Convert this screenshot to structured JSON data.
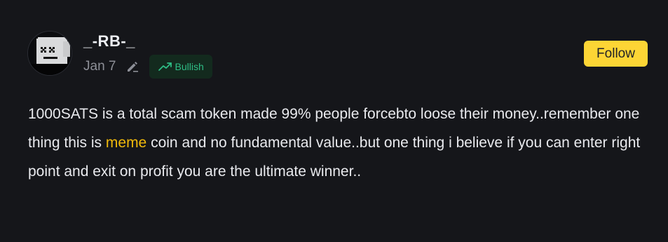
{
  "author": {
    "username": "_-RB-_",
    "avatar_icon": "pixel-face-avatar"
  },
  "meta": {
    "date": "Jan 7",
    "edit_icon": "pencil-icon",
    "sentiment": {
      "label": "Bullish",
      "icon": "trend-up-icon",
      "color": "#2ebd85"
    }
  },
  "follow_button": {
    "label": "Follow",
    "color": "#fcd535"
  },
  "content": {
    "part1": "1000SATS is a total scam token made 99% people forcebto loose their money..remember one thing this is ",
    "highlight": "meme",
    "part2": " coin and no fundamental value..but one thing i believe if you can enter right point and exit on profit you are the ultimate winner..",
    "highlight_color": "#f0b90b"
  }
}
